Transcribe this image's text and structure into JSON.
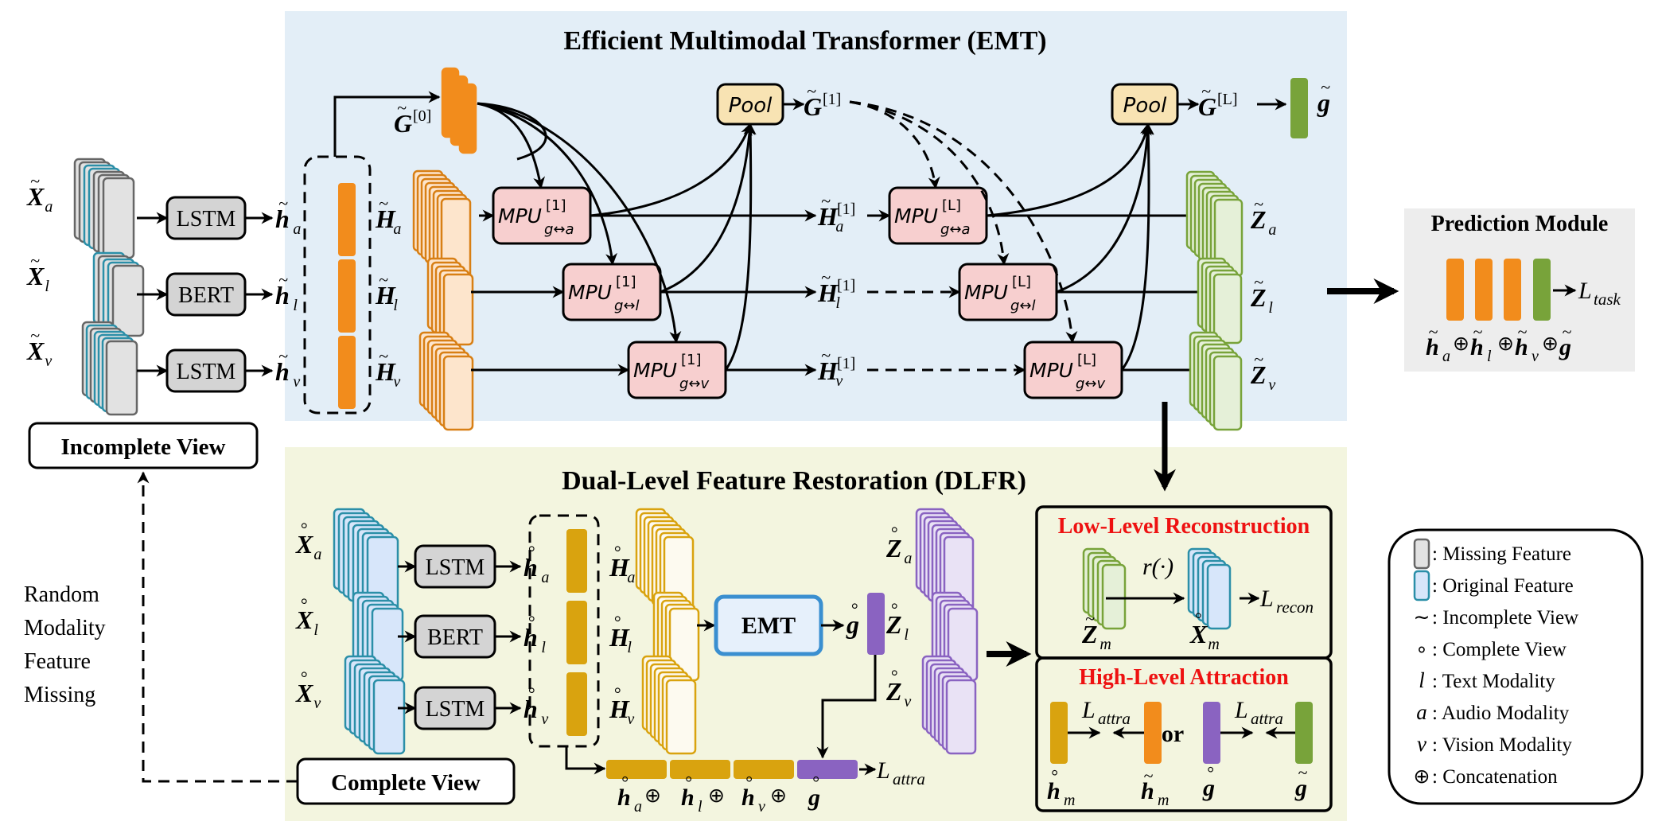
{
  "emt_panel": {
    "title": "Efficient Multimodal Transformer (EMT)",
    "inputs": [
      {
        "symbol": "X",
        "mod": "a",
        "encoder": "LSTM",
        "h": "h",
        "H": "H"
      },
      {
        "symbol": "X",
        "mod": "l",
        "encoder": "BERT",
        "h": "h",
        "H": "H"
      },
      {
        "symbol": "X",
        "mod": "v",
        "encoder": "LSTM",
        "h": "h",
        "H": "H"
      }
    ],
    "g0_label": "G",
    "g0_sup": "[0]",
    "pool_label": "Pool",
    "g1_label": "G",
    "g1_sup": "[1]",
    "gL_label": "G",
    "gL_sup": "[L]",
    "g_out": "g",
    "mpu_name": "MPU",
    "mpu_layer1": "[1]",
    "mpu_layerL": "[L]",
    "mpu_subs": [
      "g↔a",
      "g↔l",
      "g↔v"
    ],
    "hidden_mid": "H",
    "hidden_mid_sup": "[1]",
    "outputs": [
      "Z",
      "Z",
      "Z"
    ],
    "mods": [
      "a",
      "l",
      "v"
    ]
  },
  "prediction_module": {
    "title": "Prediction Module",
    "loss": "L",
    "loss_sub": "task",
    "concat_terms": [
      "h",
      "h",
      "h",
      "g"
    ],
    "concat_subs": [
      "a",
      "l",
      "v",
      ""
    ],
    "concat_op": "⊕"
  },
  "incomplete_view": {
    "label": "Incomplete View"
  },
  "complete_view": {
    "label": "Complete View"
  },
  "random_missing": {
    "lines": [
      "Random",
      "Modality",
      "Feature",
      "Missing"
    ]
  },
  "dlfr_panel": {
    "title": "Dual-Level Feature Restoration (DLFR)",
    "encoders": [
      "LSTM",
      "BERT",
      "LSTM"
    ],
    "mods": [
      "a",
      "l",
      "v"
    ],
    "emt_box": "EMT",
    "g_label": "g",
    "z_label": "Z",
    "concat_terms": [
      "h",
      "h",
      "h",
      "g"
    ],
    "concat_subs": [
      "a",
      "l",
      "v",
      ""
    ],
    "concat_op": "⊕",
    "loss": "L",
    "loss_sub": "attra"
  },
  "low_level": {
    "title": "Low-Level Reconstruction",
    "func": "r(·)",
    "from": "Z",
    "to": "X",
    "sub": "m",
    "loss": "L",
    "loss_sub": "recon"
  },
  "high_level": {
    "title": "High-Level Attraction",
    "or_label": "or",
    "loss": "L",
    "loss_sub": "attra",
    "terms": [
      "h",
      "h",
      "g",
      "g"
    ],
    "subs": [
      "m",
      "m",
      "",
      ""
    ]
  },
  "legend": {
    "items": [
      {
        "key": "",
        "text": ": Missing Feature",
        "swatch": "missing"
      },
      {
        "key": "",
        "text": ": Original Feature",
        "swatch": "original"
      },
      {
        "key": "∼",
        "text": ": Incomplete View"
      },
      {
        "key": "∘",
        "text": ": Complete View"
      },
      {
        "key": "l",
        "text": " : Text Modality"
      },
      {
        "key": "a",
        "text": " : Audio Modality"
      },
      {
        "key": "v",
        "text": " : Vision Modality"
      },
      {
        "key": "⊕",
        "text": ": Concatenation"
      }
    ]
  },
  "colors": {
    "emt_bg": "#e3eef7",
    "dlfr_bg": "#f3f5df",
    "pred_bg": "#ededed",
    "orange": "#f28c1c",
    "orange_light": "#fde5cc",
    "gold": "#d9a30f",
    "gold_light": "#fdfaf0",
    "purple": "#8a63c1",
    "purple_light": "#e9e2f5",
    "green": "#78a33a",
    "green_light": "#e5f0d8",
    "blue_border": "#2b8fa8",
    "blue_fill": "#d7e6fa",
    "gray_fill": "#e2e2e2",
    "gray_border": "#666666",
    "mpu_fill": "#f7cfcf",
    "pool_fill": "#f8e3b3",
    "emt_box_border": "#3a8fd0",
    "emt_box_fill": "#e6f0fb",
    "red": "#ee1111"
  }
}
